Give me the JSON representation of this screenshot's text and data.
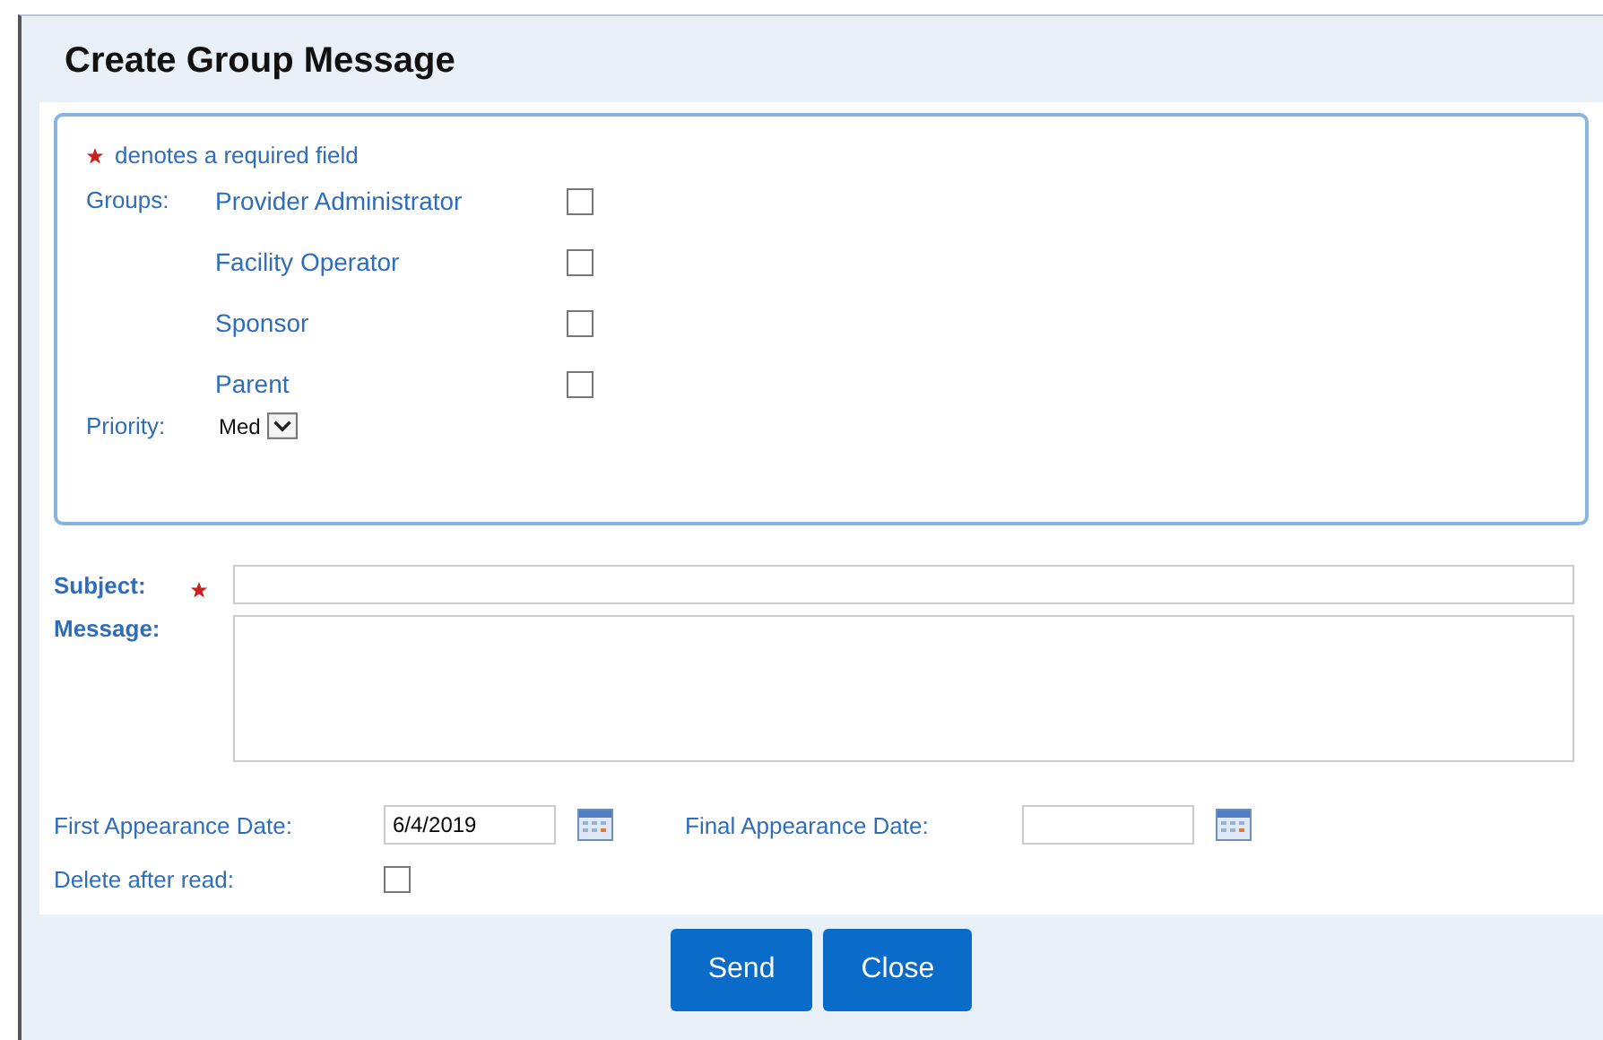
{
  "dialog": {
    "title": "Create Group Message"
  },
  "required_note": "denotes a required field",
  "groups": {
    "label": "Groups:",
    "items": [
      {
        "label": "Provider Administrator",
        "checked": false
      },
      {
        "label": "Facility Operator",
        "checked": false
      },
      {
        "label": "Sponsor",
        "checked": false
      },
      {
        "label": "Parent",
        "checked": false
      }
    ]
  },
  "priority": {
    "label": "Priority:",
    "value": "Med"
  },
  "subject": {
    "label": "Subject:",
    "required": true
  },
  "message": {
    "label": "Message:"
  },
  "first_appearance_date": {
    "label": "First Appearance Date:",
    "value": "6/4/2019"
  },
  "final_appearance_date": {
    "label": "Final Appearance Date:"
  },
  "delete_after_read": {
    "label": "Delete after read:",
    "checked": false
  },
  "buttons": [
    "Send",
    "Close"
  ]
}
